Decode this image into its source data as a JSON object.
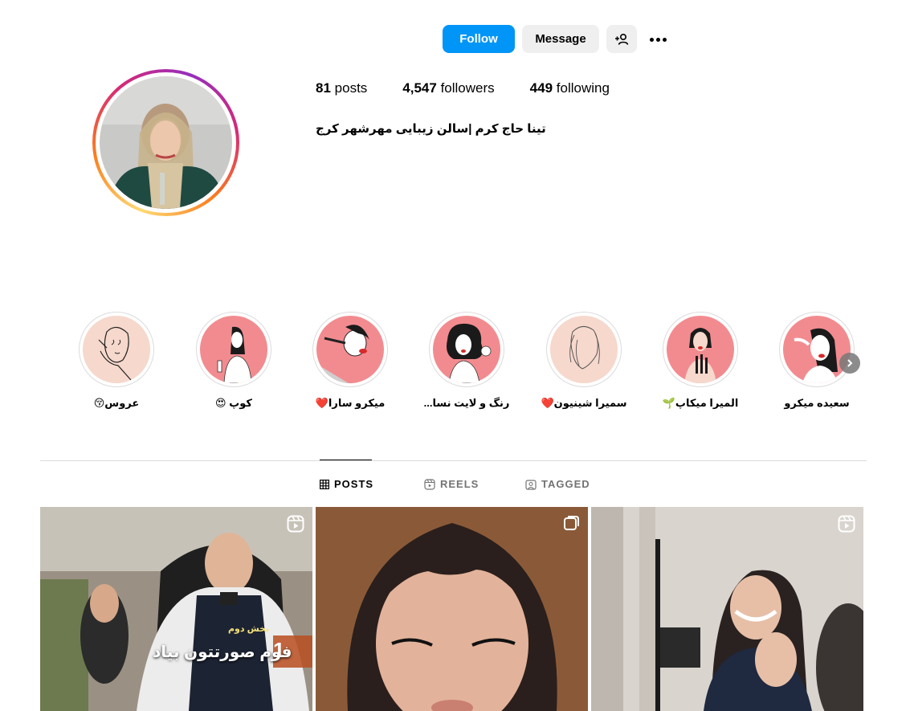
{
  "header": {
    "follow_label": "Follow",
    "message_label": "Message"
  },
  "profile": {
    "posts_count": "81",
    "posts_label": "posts",
    "followers_count": "4,547",
    "followers_label": "followers",
    "following_count": "449",
    "following_label": "following",
    "bio": "تینا حاج کرم |سالن زیبایی مهرشهر کرج"
  },
  "highlights": [
    {
      "label": "عروس😚"
    },
    {
      "label": "کوپ 😍"
    },
    {
      "label": "میکرو سارا❤️"
    },
    {
      "label": "رنگ و لایت نسا..."
    },
    {
      "label": "سمیرا شینیون❤️"
    },
    {
      "label": "المیرا میکاپ🌱"
    },
    {
      "label": "سعیده میکرو"
    }
  ],
  "tabs": {
    "posts": "POSTS",
    "reels": "REELS",
    "tagged": "TAGGED"
  },
  "posts": [
    {
      "badge": "reel-icon",
      "overlay_text": "فوم صورتتون بیاد",
      "overlay_number": "1",
      "overlay_tag": "بخش دوم"
    },
    {
      "badge": "carousel-icon"
    },
    {
      "badge": "reel-icon"
    }
  ],
  "colors": {
    "accent": "#0095f6",
    "secondary_button": "#efefef",
    "muted_text": "#737373",
    "border": "#dbdbdb",
    "highlight_pink": "#f28b8f",
    "highlight_beige": "#f6d8cc"
  }
}
